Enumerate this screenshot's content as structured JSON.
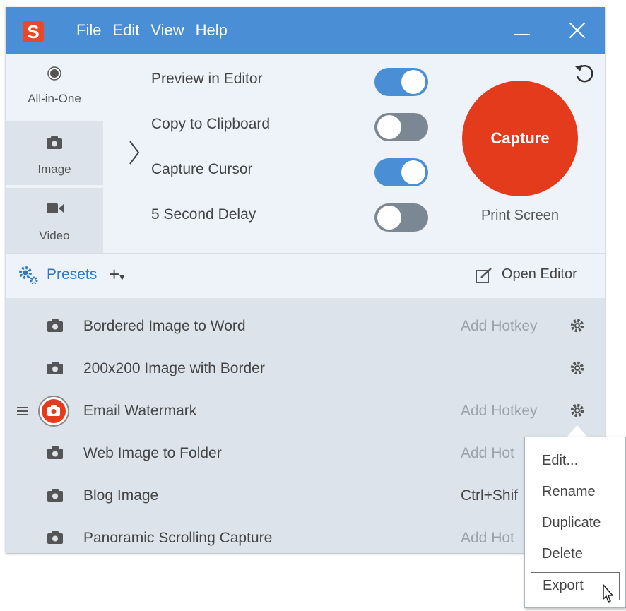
{
  "caption": "Open Presets configuration dialog and customize existing presets through the context menu",
  "app": {
    "menu": [
      "File",
      "Edit",
      "View",
      "Help"
    ]
  },
  "modes": [
    {
      "label": "All-in-One",
      "active": true
    },
    {
      "label": "Image",
      "active": false
    },
    {
      "label": "Video",
      "active": false
    }
  ],
  "options": [
    {
      "label": "Preview in Editor",
      "on": true
    },
    {
      "label": "Copy to Clipboard",
      "on": false
    },
    {
      "label": "Capture Cursor",
      "on": true
    },
    {
      "label": "5 Second Delay",
      "on": false
    }
  ],
  "capture": {
    "button_label": "Capture",
    "shortcut": "Print Screen"
  },
  "presets_bar": {
    "label": "Presets",
    "add": "+",
    "open_editor": "Open Editor"
  },
  "presets": [
    {
      "name": "Bordered Image to Word",
      "hotkey": "Add Hotkey",
      "hotkey_set": false,
      "gear": true
    },
    {
      "name": "200x200 Image with Border",
      "hotkey": "",
      "hotkey_set": false,
      "gear": true
    },
    {
      "name": "Email Watermark",
      "hotkey": "Add Hotkey",
      "hotkey_set": false,
      "gear": true,
      "selected": true
    },
    {
      "name": "Web Image to Folder",
      "hotkey": "Add Hot",
      "hotkey_set": false,
      "gear": false
    },
    {
      "name": "Blog Image",
      "hotkey": "Ctrl+Shif",
      "hotkey_set": true,
      "gear": false
    },
    {
      "name": "Panoramic Scrolling Capture",
      "hotkey": "Add Hot",
      "hotkey_set": false,
      "gear": false
    }
  ],
  "context_menu": {
    "items": [
      "Edit...",
      "Rename",
      "Duplicate",
      "Delete",
      "Export"
    ],
    "hovered": "Export"
  },
  "colors": {
    "titlebar": "#4a8fd6",
    "capture": "#e43b1d",
    "accent": "#2f79c4"
  }
}
